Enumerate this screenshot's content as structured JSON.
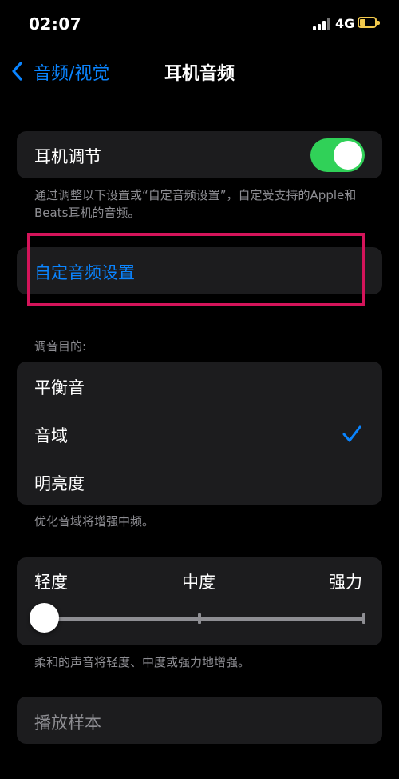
{
  "status_bar": {
    "time": "02:07",
    "network": "4G"
  },
  "nav": {
    "back_label": "音频/视觉",
    "title": "耳机音频"
  },
  "headphone_accommodation": {
    "label": "耳机调节",
    "enabled": true,
    "footnote": "通过调整以下设置或“自定音频设置”，自定受支持的Apple和Beats耳机的音频。"
  },
  "custom_audio_setup": {
    "label": "自定音频设置"
  },
  "tune_for": {
    "header": "调音目的:",
    "options": [
      "平衡音",
      "音域",
      "明亮度"
    ],
    "selected": "音域",
    "footnote": "优化音域将增强中频。"
  },
  "boost": {
    "labels": [
      "轻度",
      "中度",
      "强力"
    ],
    "value_fraction": 0.0,
    "footnote": "柔和的声音将轻度、中度或强力地增强。"
  },
  "play_sample": {
    "label": "播放样本"
  },
  "colors": {
    "background": "#000000",
    "card": "#1c1c1e",
    "accent_blue": "#0a84ff",
    "toggle_on": "#30d158",
    "highlight": "#d4145a"
  }
}
